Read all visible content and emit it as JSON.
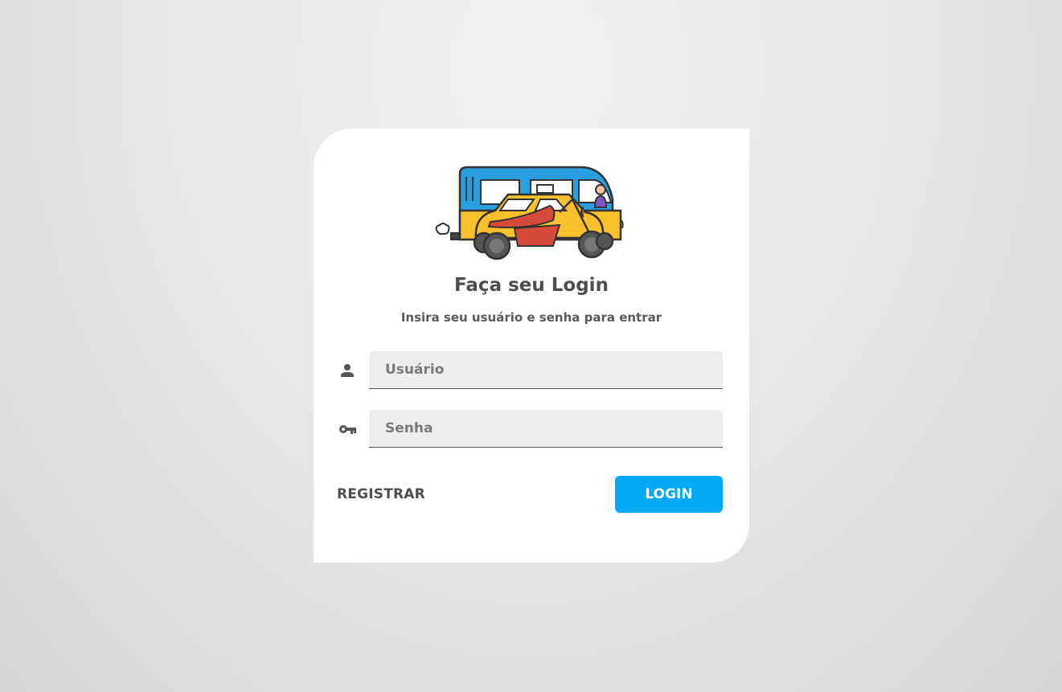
{
  "login": {
    "title": "Faça seu Login",
    "subtitle": "Insira seu usuário e senha para entrar",
    "username": {
      "placeholder": "Usuário",
      "value": "",
      "icon": "person-icon"
    },
    "password": {
      "placeholder": "Senha",
      "value": "",
      "icon": "key-icon"
    },
    "register_label": "REGISTRAR",
    "login_label": "LOGIN"
  },
  "logo": {
    "icon": "bus-car-bike-logo-icon"
  },
  "colors": {
    "primary": "#03a9f4",
    "text": "#4e4e4e",
    "field_bg": "#eeeeee",
    "bus_blue": "#2a9fe0",
    "car_yellow": "#fbc02d",
    "bike_red": "#d84b3a"
  }
}
